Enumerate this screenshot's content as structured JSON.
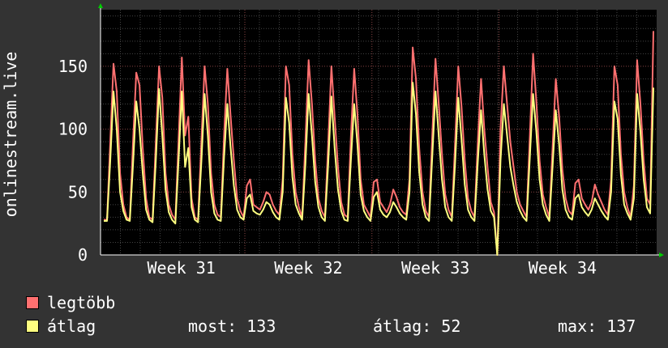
{
  "chart_data": {
    "type": "line",
    "title": "",
    "ylabel": "onlinestream.live",
    "ylim": [
      0,
      195
    ],
    "yticks": [
      0,
      50,
      100,
      150
    ],
    "xticks": [
      "Week 31",
      "Week 32",
      "Week 33",
      "Week 34"
    ],
    "grid": true,
    "series": [
      {
        "name": "legtöbb",
        "color": "#ff7070",
        "values": [
          28,
          28,
          90,
          152,
          130,
          65,
          40,
          30,
          28,
          90,
          145,
          135,
          85,
          45,
          30,
          28,
          90,
          150,
          125,
          65,
          40,
          32,
          28,
          92,
          157,
          95,
          110,
          45,
          30,
          28,
          90,
          150,
          120,
          65,
          40,
          32,
          30,
          95,
          148,
          110,
          75,
          45,
          35,
          30,
          55,
          60,
          40,
          38,
          36,
          42,
          50,
          48,
          40,
          35,
          32,
          60,
          150,
          135,
          80,
          50,
          38,
          30,
          90,
          155,
          120,
          75,
          45,
          35,
          30,
          88,
          150,
          110,
          70,
          42,
          32,
          30,
          95,
          148,
          112,
          60,
          40,
          35,
          30,
          58,
          60,
          42,
          38,
          34,
          40,
          52,
          46,
          38,
          34,
          32,
          60,
          165,
          140,
          85,
          50,
          35,
          30,
          95,
          156,
          120,
          80,
          48,
          36,
          30,
          88,
          150,
          118,
          75,
          45,
          35,
          30,
          90,
          140,
          100,
          70,
          42,
          34,
          0,
          100,
          150,
          120,
          90,
          70,
          50,
          40,
          35,
          30,
          95,
          160,
          122,
          75,
          48,
          38,
          30,
          85,
          140,
          110,
          68,
          45,
          35,
          32,
          57,
          60,
          45,
          40,
          36,
          42,
          56,
          48,
          42,
          36,
          32,
          60,
          150,
          135,
          80,
          50,
          38,
          30,
          55,
          155,
          120,
          75,
          45,
          40,
          178
        ]
      },
      {
        "name": "átlag",
        "color": "#ffff80",
        "values": [
          27,
          27,
          75,
          130,
          100,
          50,
          35,
          28,
          27,
          72,
          122,
          100,
          65,
          36,
          28,
          26,
          75,
          132,
          95,
          52,
          34,
          28,
          25,
          76,
          130,
          70,
          85,
          38,
          28,
          26,
          74,
          128,
          95,
          50,
          33,
          28,
          27,
          78,
          120,
          85,
          55,
          36,
          30,
          28,
          45,
          48,
          35,
          33,
          32,
          36,
          42,
          40,
          34,
          30,
          28,
          50,
          125,
          105,
          62,
          40,
          33,
          28,
          72,
          128,
          95,
          58,
          38,
          30,
          27,
          72,
          126,
          85,
          52,
          35,
          28,
          27,
          76,
          120,
          88,
          48,
          35,
          30,
          27,
          46,
          50,
          36,
          32,
          30,
          34,
          42,
          38,
          33,
          30,
          28,
          50,
          137,
          112,
          66,
          40,
          30,
          27,
          78,
          130,
          95,
          60,
          38,
          30,
          27,
          72,
          125,
          92,
          56,
          36,
          30,
          27,
          74,
          115,
          80,
          52,
          35,
          30,
          0,
          75,
          120,
          95,
          70,
          55,
          42,
          35,
          30,
          27,
          78,
          128,
          98,
          60,
          40,
          32,
          27,
          70,
          115,
          88,
          52,
          36,
          30,
          28,
          45,
          48,
          38,
          34,
          31,
          36,
          45,
          40,
          35,
          31,
          28,
          50,
          122,
          108,
          64,
          40,
          33,
          28,
          45,
          128,
          98,
          60,
          38,
          33,
          133
        ]
      }
    ]
  },
  "legend": {
    "max_label": "legtöbb",
    "avg_label": "átlag"
  },
  "stats": {
    "now": "most: 133",
    "avg": "átlag: 52",
    "max": "max: 137"
  }
}
